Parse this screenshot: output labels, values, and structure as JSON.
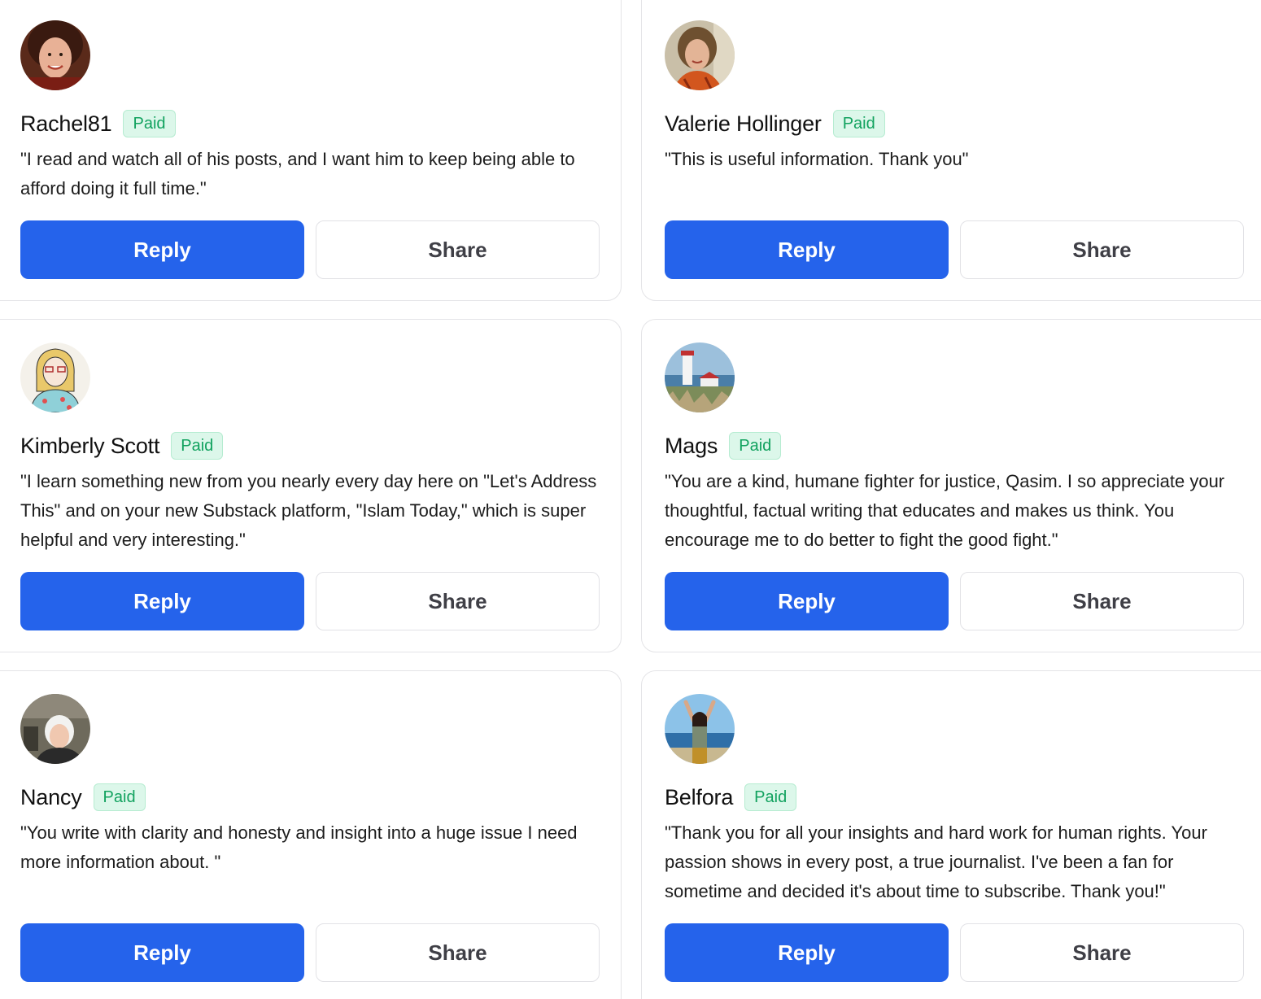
{
  "comments": [
    {
      "name": "Rachel81",
      "badge": "Paid",
      "quote": "\"I read and watch all of his posts, and I want him to keep being able to afford doing it full time.\"",
      "reply_label": "Reply",
      "share_label": "Share"
    },
    {
      "name": "Valerie Hollinger",
      "badge": "Paid",
      "quote": "\"This is useful information. Thank you\"",
      "reply_label": "Reply",
      "share_label": "Share"
    },
    {
      "name": "Kimberly Scott",
      "badge": "Paid",
      "quote": "\"I learn something new from you nearly every day here on \"Let's Address This\" and on your new Substack platform, \"Islam Today,\" which is super helpful and very interesting.\"",
      "reply_label": "Reply",
      "share_label": "Share"
    },
    {
      "name": "Mags",
      "badge": "Paid",
      "quote": "\"You are a kind, humane fighter for justice, Qasim. I so appreciate your thoughtful, factual writing that educates and makes us think. You encourage me to do better to fight the good fight.\"",
      "reply_label": "Reply",
      "share_label": "Share"
    },
    {
      "name": "Nancy",
      "badge": "Paid",
      "quote": "\"You write with clarity and honesty and insight into a huge issue I need more information about. \"",
      "reply_label": "Reply",
      "share_label": "Share"
    },
    {
      "name": "Belfora",
      "badge": "Paid",
      "quote": "\"Thank you for all your insights and hard work for human rights. Your passion shows in every post, a true journalist. I've been a fan for sometime and decided it's about time to subscribe. Thank you!\"",
      "reply_label": "Reply",
      "share_label": "Share"
    }
  ],
  "colors": {
    "reply_button": "#2563eb",
    "paid_badge_bg": "#dcf7ea",
    "paid_badge_text": "#12a25f"
  }
}
